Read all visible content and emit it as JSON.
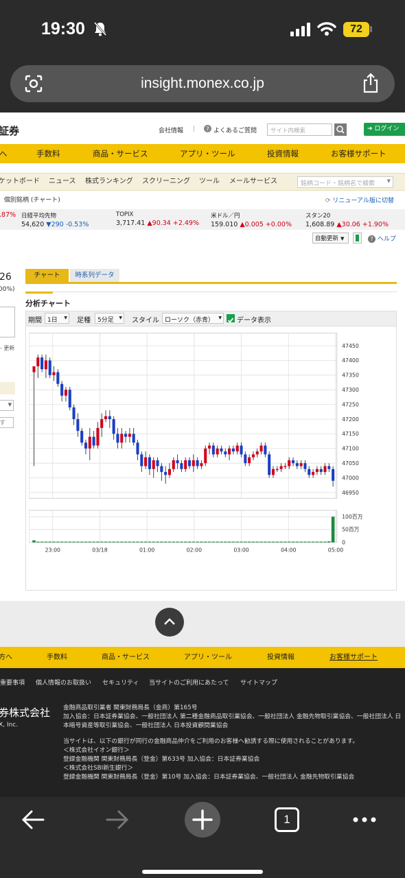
{
  "status_bar": {
    "time": "19:30",
    "battery": "72"
  },
  "browser": {
    "url": "insight.monex.co.jp"
  },
  "header": {
    "logo_text": "証券",
    "links": [
      "会社情報",
      "よくあるご質問"
    ],
    "search_placeholder": "サイト内検索",
    "login_label": "ログイン"
  },
  "main_nav": [
    "へ",
    "手数料",
    "商品・サービス",
    "アプリ・ツール",
    "投資情報",
    "お客様サポート"
  ],
  "sub_nav": [
    "ケットボード",
    "ニュース",
    "株式ランキング",
    "スクリーニング",
    "ツール",
    "メールサービス"
  ],
  "stock_search_placeholder": "銘柄コード・銘柄名で検索",
  "breadcrumb": "個別銘柄 (チャート)",
  "renewal_link": "リニューアル版に切替",
  "tickers": [
    {
      "name": "",
      "value": "",
      "change": ".87%",
      "dir": "up"
    },
    {
      "name": "日経平均先物",
      "value": "54,620",
      "change": "▼290 -0.53%",
      "dir": "down"
    },
    {
      "name": "TOPIX",
      "value": "3,717.41",
      "change": "▲90.34 +2.49%",
      "dir": "up"
    },
    {
      "name": "米ドル／円",
      "value": "159.010",
      "change": "▲0.005 +0.00%",
      "dir": "up"
    },
    {
      "name": "スタン20",
      "value": "1,608.89",
      "change": "▲30.06 +1.90%",
      "dir": "up"
    }
  ],
  "auto_update": "自動更新",
  "help": "ヘルプ",
  "left_panel": {
    "price": "26",
    "pct": "00%)",
    "update": "- 更新",
    "input": "す"
  },
  "tabs": [
    "チャート",
    "時系列データ"
  ],
  "chart_title": "分析チャート",
  "toolbar": {
    "period_label": "期間",
    "period_value": "1日",
    "kind_label": "足種",
    "kind_value": "5分足",
    "style_label": "スタイル",
    "style_value": "ローソク（赤青）",
    "data_label": "データ表示"
  },
  "chart_data": {
    "type": "candlestick",
    "x_ticks": [
      "23:00",
      "03/18",
      "01:00",
      "02:00",
      "03:00",
      "04:00",
      "05:00"
    ],
    "y_ticks": [
      "47450",
      "47400",
      "47350",
      "47300",
      "47250",
      "47200",
      "47150",
      "47100",
      "47050",
      "47000",
      "46950"
    ],
    "ylim": [
      46930,
      47480
    ],
    "volume_ticks": [
      "100百万",
      "50百万",
      "0"
    ],
    "volume_ylim": [
      0,
      110
    ],
    "up_color": "#d0021b",
    "down_color": "#1a3fc4",
    "volume_color": "#1d8a3e",
    "candles": [
      [
        47360,
        47380,
        47040,
        47380
      ],
      [
        47380,
        47420,
        47340,
        47410
      ],
      [
        47410,
        47420,
        47360,
        47370
      ],
      [
        47370,
        47420,
        47340,
        47400
      ],
      [
        47400,
        47410,
        47340,
        47350
      ],
      [
        47350,
        47380,
        47330,
        47360
      ],
      [
        47360,
        47370,
        47310,
        47320
      ],
      [
        47320,
        47330,
        47260,
        47280
      ],
      [
        47280,
        47310,
        47260,
        47300
      ],
      [
        47300,
        47310,
        47230,
        47240
      ],
      [
        47240,
        47250,
        47180,
        47200
      ],
      [
        47200,
        47220,
        47140,
        47160
      ],
      [
        47160,
        47170,
        47110,
        47120
      ],
      [
        47120,
        47130,
        47080,
        47100
      ],
      [
        47100,
        47170,
        47060,
        47140
      ],
      [
        47140,
        47160,
        47100,
        47110
      ],
      [
        47110,
        47190,
        47100,
        47170
      ],
      [
        47170,
        47220,
        47140,
        47200
      ],
      [
        47200,
        47230,
        47190,
        47210
      ],
      [
        47210,
        47230,
        47170,
        47200
      ],
      [
        47200,
        47210,
        47130,
        47150
      ],
      [
        47150,
        47170,
        47100,
        47120
      ],
      [
        47120,
        47170,
        47100,
        47150
      ],
      [
        47150,
        47160,
        47120,
        47140
      ],
      [
        47140,
        47170,
        47120,
        47150
      ],
      [
        47150,
        47170,
        47110,
        47120
      ],
      [
        47120,
        47130,
        47060,
        47080
      ],
      [
        47080,
        47090,
        47020,
        47040
      ],
      [
        47040,
        47090,
        47030,
        47070
      ],
      [
        47070,
        47080,
        47010,
        47030
      ],
      [
        47030,
        47070,
        47000,
        47060
      ],
      [
        47060,
        47070,
        47020,
        47040
      ],
      [
        47040,
        47050,
        46990,
        47020
      ],
      [
        47020,
        47040,
        46980,
        47010
      ],
      [
        47010,
        47050,
        47000,
        47030
      ],
      [
        47030,
        47070,
        47020,
        47060
      ],
      [
        47060,
        47080,
        47030,
        47050
      ],
      [
        47050,
        47060,
        47020,
        47030
      ],
      [
        47030,
        47070,
        47020,
        47060
      ],
      [
        47060,
        47070,
        47030,
        47040
      ],
      [
        47040,
        47080,
        47020,
        47060
      ],
      [
        47060,
        47070,
        47030,
        47040
      ],
      [
        47040,
        47060,
        47030,
        47050
      ],
      [
        47050,
        47110,
        47040,
        47100
      ],
      [
        47100,
        47120,
        47080,
        47110
      ],
      [
        47110,
        47120,
        47070,
        47080
      ],
      [
        47080,
        47110,
        47070,
        47100
      ],
      [
        47100,
        47110,
        47080,
        47090
      ],
      [
        47090,
        47100,
        47070,
        47080
      ],
      [
        47080,
        47110,
        47060,
        47100
      ],
      [
        47100,
        47110,
        47080,
        47090
      ],
      [
        47090,
        47120,
        47080,
        47110
      ],
      [
        47110,
        47120,
        47070,
        47080
      ],
      [
        47080,
        47090,
        47040,
        47050
      ],
      [
        47050,
        47080,
        47040,
        47070
      ],
      [
        47070,
        47090,
        47060,
        47080
      ],
      [
        47080,
        47100,
        47070,
        47090
      ],
      [
        47090,
        47120,
        47080,
        47110
      ],
      [
        47110,
        47120,
        47070,
        47080
      ],
      [
        47080,
        47090,
        47000,
        47010
      ],
      [
        47010,
        47040,
        47000,
        47030
      ],
      [
        47030,
        47040,
        47020,
        47030
      ],
      [
        47030,
        47050,
        47020,
        47040
      ],
      [
        47040,
        47050,
        47030,
        47040
      ],
      [
        47040,
        47070,
        47030,
        47060
      ],
      [
        47060,
        47070,
        47040,
        47050
      ],
      [
        47050,
        47060,
        47030,
        47040
      ],
      [
        47040,
        47060,
        47030,
        47050
      ],
      [
        47050,
        47060,
        47020,
        47030
      ],
      [
        47030,
        47040,
        47000,
        47010
      ],
      [
        47010,
        47030,
        47000,
        47020
      ],
      [
        47020,
        47040,
        47010,
        47030
      ],
      [
        47030,
        47040,
        47010,
        47020
      ],
      [
        47020,
        47050,
        47010,
        47040
      ],
      [
        47040,
        47050,
        47020,
        47030
      ],
      [
        47030,
        47040,
        46970,
        46990
      ]
    ],
    "volumes": [
      8,
      3,
      3,
      3,
      3,
      3,
      3,
      3,
      3,
      3,
      3,
      3,
      3,
      3,
      3,
      3,
      3,
      3,
      3,
      3,
      3,
      3,
      3,
      3,
      3,
      3,
      3,
      3,
      3,
      3,
      3,
      3,
      3,
      3,
      3,
      3,
      3,
      3,
      3,
      3,
      3,
      3,
      3,
      3,
      3,
      3,
      3,
      3,
      3,
      3,
      3,
      3,
      3,
      3,
      3,
      3,
      3,
      3,
      3,
      3,
      3,
      3,
      3,
      3,
      3,
      3,
      3,
      3,
      3,
      3,
      3,
      3,
      3,
      3,
      4,
      100
    ]
  },
  "footer_nav": [
    "方へ",
    "手数料",
    "商品・サービス",
    "アプリ・ツール",
    "投資情報",
    "お客様サポート"
  ],
  "footer_links": [
    "重要事項",
    "個人情報のお取扱い",
    "セキュリティ",
    "当サイトのご利用にあたって",
    "サイトマップ"
  ],
  "footer_company": "券株式会社",
  "footer_company_en": "X, Inc.",
  "footer_reg": [
    "金融商品取引業者 関東財務局長（金商）第165号",
    "加入協会：日本証券業協会、一般社団法人 第二種金融商品取引業協会、一般社団法人 金融先物取引業協会、一般社団法人 日本暗号資産等取引業協会、一般社団法人 日本投資顧問業協会"
  ],
  "footer_banks": [
    "当サイトは、以下の銀行が同行の金融商品仲介をご利用のお客様へ勧誘する際に使用されることがあります。",
    "＜株式会社イオン銀行＞",
    "登録金融機関 関東財務局長（登金）第633号 加入協会：日本証券業協会",
    "＜株式会社SBI新生銀行＞",
    "登録金融機関 関東財務局長（登金）第10号 加入協会：日本証券業協会、一般社団法人 金融先物取引業協会"
  ],
  "tab_count": "1"
}
